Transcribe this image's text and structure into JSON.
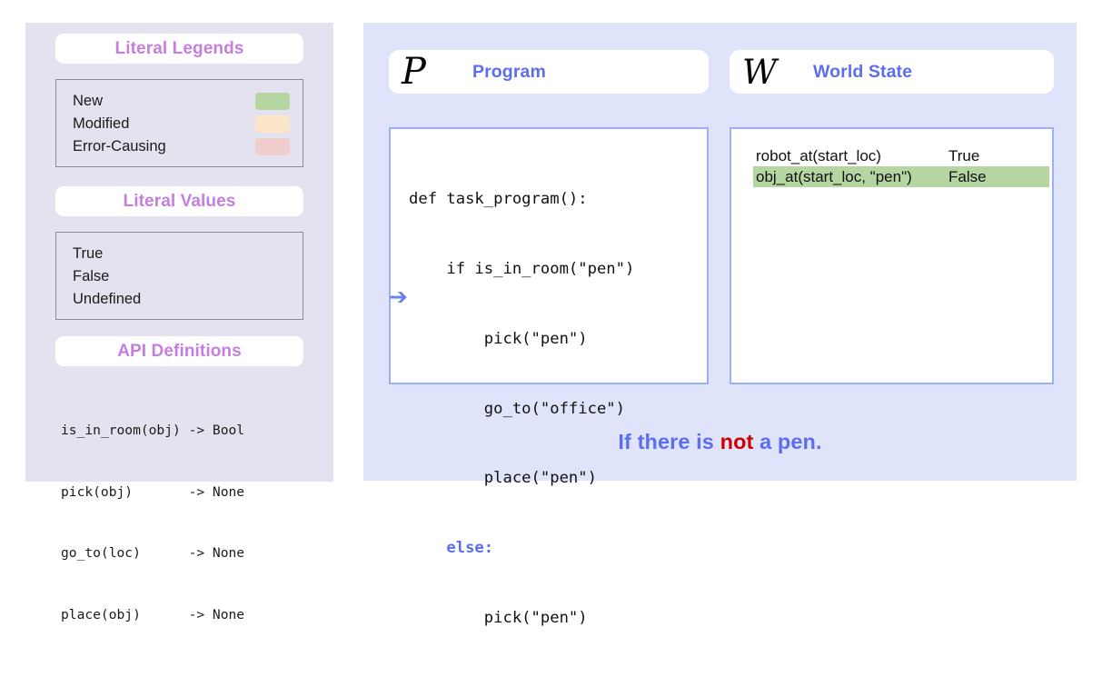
{
  "colors": {
    "left_panel_bg": "#e4e2ef",
    "right_panel_bg": "#e0e4fa",
    "pill_title": "#c67ede",
    "head_label": "#5b6ef0",
    "box_border": "#9eb0f5",
    "legend_box_border": "#8d8d97",
    "new_swatch": "#b5d6a0",
    "modified_swatch": "#fce6c8",
    "error_swatch": "#f2cdcd",
    "arrow": "#6b7ef0",
    "negation": "#cc0000",
    "highlight_green": "#b5d6a0"
  },
  "left_panel": {
    "legends": {
      "title": "Literal Legends",
      "rows": [
        {
          "label": "New",
          "swatch": "#b5d6a0"
        },
        {
          "label": "Modified",
          "swatch": "#fce6c8"
        },
        {
          "label": "Error-Causing",
          "swatch": "#f2cdcd"
        }
      ]
    },
    "values": {
      "title": "Literal Values",
      "rows": [
        "True",
        "False",
        "Undefined"
      ]
    },
    "api": {
      "title": "API Definitions",
      "lines": [
        "is_in_room(obj) -> Bool",
        "pick(obj)       -> None",
        "go_to(loc)      -> None",
        "place(obj)      -> None"
      ]
    }
  },
  "right_panel": {
    "program": {
      "glyph": "P",
      "glyph_name": "script-capital-p",
      "label": "Program",
      "code_lines": [
        {
          "text": "def task_program():",
          "highlighted": false
        },
        {
          "text": "    if is_in_room(\"pen\")",
          "highlighted": false
        },
        {
          "text": "        pick(\"pen\")",
          "highlighted": false
        },
        {
          "text": "        go_to(\"office\")",
          "highlighted": false
        },
        {
          "text": "        place(\"pen\")",
          "highlighted": false
        },
        {
          "text": "    else:",
          "highlighted": true
        },
        {
          "text": "        pick(\"pen\")",
          "highlighted": false
        }
      ],
      "execution_pointer": "➔"
    },
    "world_state": {
      "glyph": "W",
      "glyph_name": "script-capital-w",
      "label": "World State",
      "rows": [
        {
          "predicate": "robot_at(start_loc)",
          "value": "True",
          "highlighted": false
        },
        {
          "predicate": "obj_at(start_loc, \"pen\")",
          "value": "False",
          "highlighted": true
        }
      ]
    },
    "caption": {
      "prefix": "If there is ",
      "negation": "not",
      "suffix": " a pen."
    }
  }
}
